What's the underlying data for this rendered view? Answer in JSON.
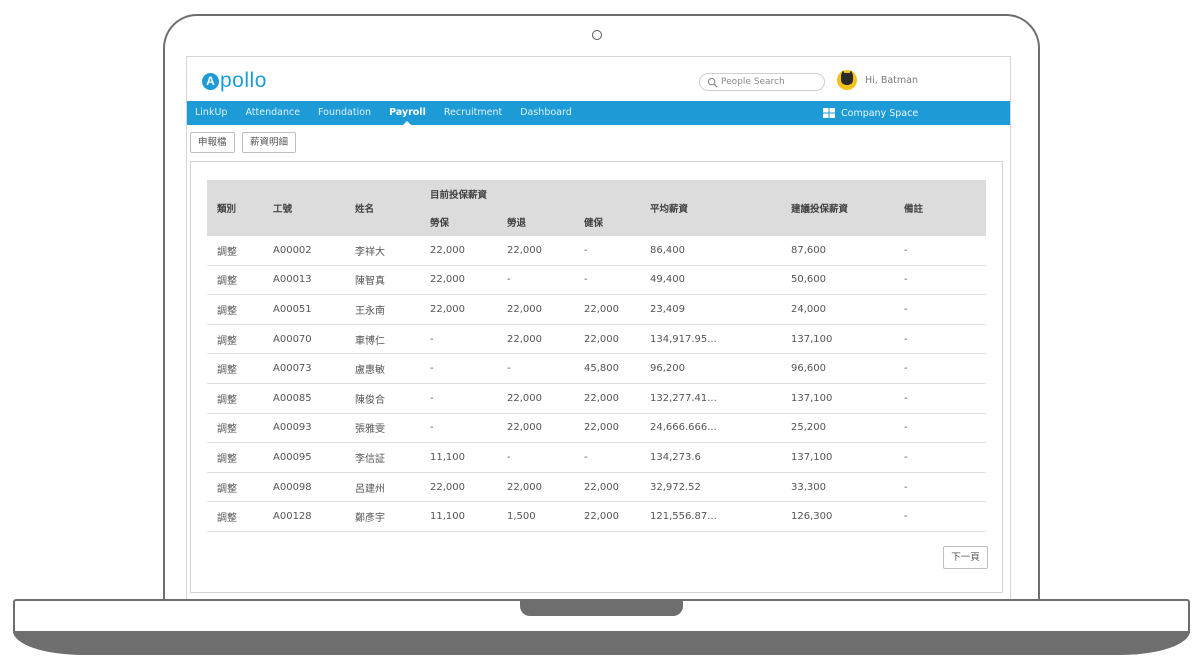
{
  "app": {
    "logo_initial": "A",
    "logo_text": "pollo"
  },
  "header": {
    "search_placeholder": "People Search",
    "greeting": "Hi, Batman"
  },
  "nav": {
    "items": [
      {
        "label": "LinkUp",
        "active": false
      },
      {
        "label": "Attendance",
        "active": false
      },
      {
        "label": "Foundation",
        "active": false
      },
      {
        "label": "Payroll",
        "active": true
      },
      {
        "label": "Recruitment",
        "active": false
      },
      {
        "label": "Dashboard",
        "active": false
      }
    ],
    "company_space": "Company Space"
  },
  "subtabs": [
    "申報檔",
    "薪資明細"
  ],
  "table": {
    "headers": {
      "category": "類別",
      "emp_no": "工號",
      "name": "姓名",
      "current_insured": "目前投保薪資",
      "labor_insurance": "勞保",
      "labor_pension": "勞退",
      "health_insurance": "健保",
      "avg_salary": "平均薪資",
      "suggested": "建議投保薪資",
      "notes": "備註"
    },
    "rows": [
      [
        "調整",
        "A00002",
        "李祥大",
        "22,000",
        "22,000",
        "-",
        "86,400",
        "87,600",
        "-"
      ],
      [
        "調整",
        "A00013",
        "陳智真",
        "22,000",
        "-",
        "-",
        "49,400",
        "50,600",
        "-"
      ],
      [
        "調整",
        "A00051",
        "王永南",
        "22,000",
        "22,000",
        "22,000",
        "23,409",
        "24,000",
        "-"
      ],
      [
        "調整",
        "A00070",
        "車博仁",
        "-",
        "22,000",
        "22,000",
        "134,917.95...",
        "137,100",
        "-"
      ],
      [
        "調整",
        "A00073",
        "盧惠敏",
        "-",
        "-",
        "45,800",
        "96,200",
        "96,600",
        "-"
      ],
      [
        "調整",
        "A00085",
        "陳俊合",
        "-",
        "22,000",
        "22,000",
        "132,277.41...",
        "137,100",
        "-"
      ],
      [
        "調整",
        "A00093",
        "張雅雯",
        "-",
        "22,000",
        "22,000",
        "24,666.666...",
        "25,200",
        "-"
      ],
      [
        "調整",
        "A00095",
        "李信証",
        "11,100",
        "-",
        "-",
        "134,273.6",
        "137,100",
        "-"
      ],
      [
        "調整",
        "A00098",
        "呂建州",
        "22,000",
        "22,000",
        "22,000",
        "32,972.52",
        "33,300",
        "-"
      ],
      [
        "調整",
        "A00128",
        "鄭彥宇",
        "11,100",
        "1,500",
        "22,000",
        "121,556.87...",
        "126,300",
        "-"
      ]
    ]
  },
  "pagination": {
    "next_label": "下一頁"
  },
  "colors": {
    "brand": "#1d9bd6",
    "header_bg": "#dcdcdc",
    "avatar": "#f2c21b"
  },
  "icons": {
    "search": "search-icon",
    "company": "grid-icon",
    "avatar": "batman-avatar"
  }
}
